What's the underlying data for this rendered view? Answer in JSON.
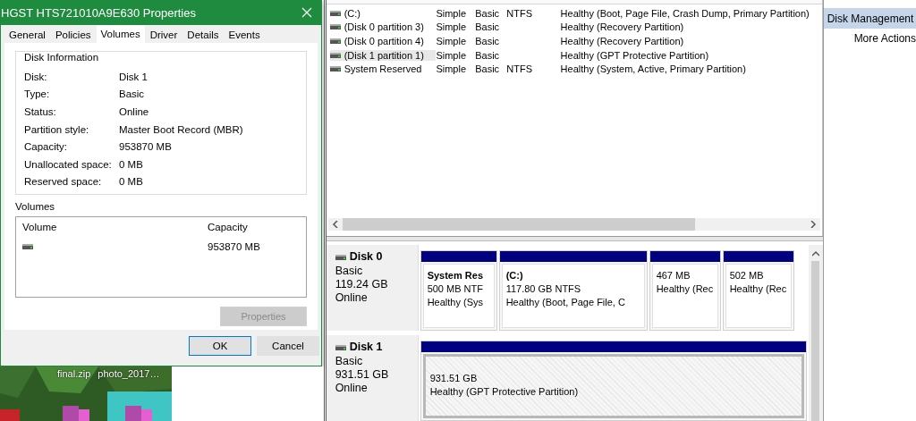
{
  "dialog": {
    "title": "HGST HTS721010A9E630 Properties",
    "tabs": [
      {
        "label": "General",
        "selected": false
      },
      {
        "label": "Policies",
        "selected": false
      },
      {
        "label": "Volumes",
        "selected": true
      },
      {
        "label": "Driver",
        "selected": false
      },
      {
        "label": "Details",
        "selected": false
      },
      {
        "label": "Events",
        "selected": false
      }
    ],
    "disk_information": {
      "title": "Disk Information",
      "fields": [
        {
          "label": "Disk:",
          "value": "Disk 1"
        },
        {
          "label": "Type:",
          "value": "Basic"
        },
        {
          "label": "Status:",
          "value": "Online"
        },
        {
          "label": "Partition style:",
          "value": "Master Boot Record (MBR)"
        },
        {
          "label": "Capacity:",
          "value": "953870 MB"
        },
        {
          "label": "Unallocated space:",
          "value": "0 MB"
        },
        {
          "label": "Reserved space:",
          "value": "0 MB"
        }
      ]
    },
    "volumes": {
      "title": "Volumes",
      "columns": [
        "Volume",
        "Capacity"
      ],
      "rows": [
        {
          "capacity": "953870 MB"
        }
      ]
    },
    "properties_button": {
      "label": "Properties",
      "disabled": true
    },
    "buttons": [
      {
        "label": "OK",
        "default": true
      },
      {
        "label": "Cancel",
        "default": false
      }
    ]
  },
  "desktop": {
    "icons": [
      {
        "label": "final.zip"
      },
      {
        "label": "photo_2017…"
      }
    ]
  },
  "volume_list": {
    "rows": [
      {
        "volume": "(C:)",
        "layout": "Simple",
        "type": "Basic",
        "file_system": "NTFS",
        "status": "Healthy (Boot, Page File, Crash Dump, Primary Partition)",
        "selected": false
      },
      {
        "volume": "(Disk 0 partition 3)",
        "layout": "Simple",
        "type": "Basic",
        "status": "Healthy (Recovery Partition)",
        "selected": false
      },
      {
        "volume": "(Disk 0 partition 4)",
        "layout": "Simple",
        "type": "Basic",
        "status": "Healthy (Recovery Partition)",
        "selected": false
      },
      {
        "volume": "(Disk 1 partition 1)",
        "layout": "Simple",
        "type": "Basic",
        "status": "Healthy (GPT Protective Partition)",
        "selected": true
      },
      {
        "volume": "System Reserved",
        "layout": "Simple",
        "type": "Basic",
        "file_system": "NTFS",
        "status": "Healthy (System, Active, Primary Partition)",
        "selected": false
      }
    ]
  },
  "disks": [
    {
      "name": "Disk 0",
      "type": "Basic",
      "size": "119.24 GB",
      "status": "Online",
      "partitions": [
        {
          "name": "System Res",
          "size": "500 MB NTF",
          "status": "Healthy (Sys",
          "selected": false
        },
        {
          "name": "(C:)",
          "size": "117.80 GB NTFS",
          "status": "Healthy (Boot, Page File, C",
          "selected": false
        },
        {
          "size": "467 MB",
          "status": "Healthy (Rec",
          "selected": false
        },
        {
          "size": "502 MB",
          "status": "Healthy (Rec",
          "selected": false
        }
      ]
    },
    {
      "name": "Disk 1",
      "type": "Basic",
      "size": "931.51 GB",
      "status": "Online",
      "partitions": [
        {
          "size": "931.51 GB",
          "status": "Healthy (GPT Protective Partition)",
          "selected": true
        }
      ]
    }
  ],
  "actions": {
    "items": [
      {
        "label": "Disk Management",
        "selected": true
      },
      {
        "label": "More Actions",
        "selected": false
      }
    ]
  }
}
